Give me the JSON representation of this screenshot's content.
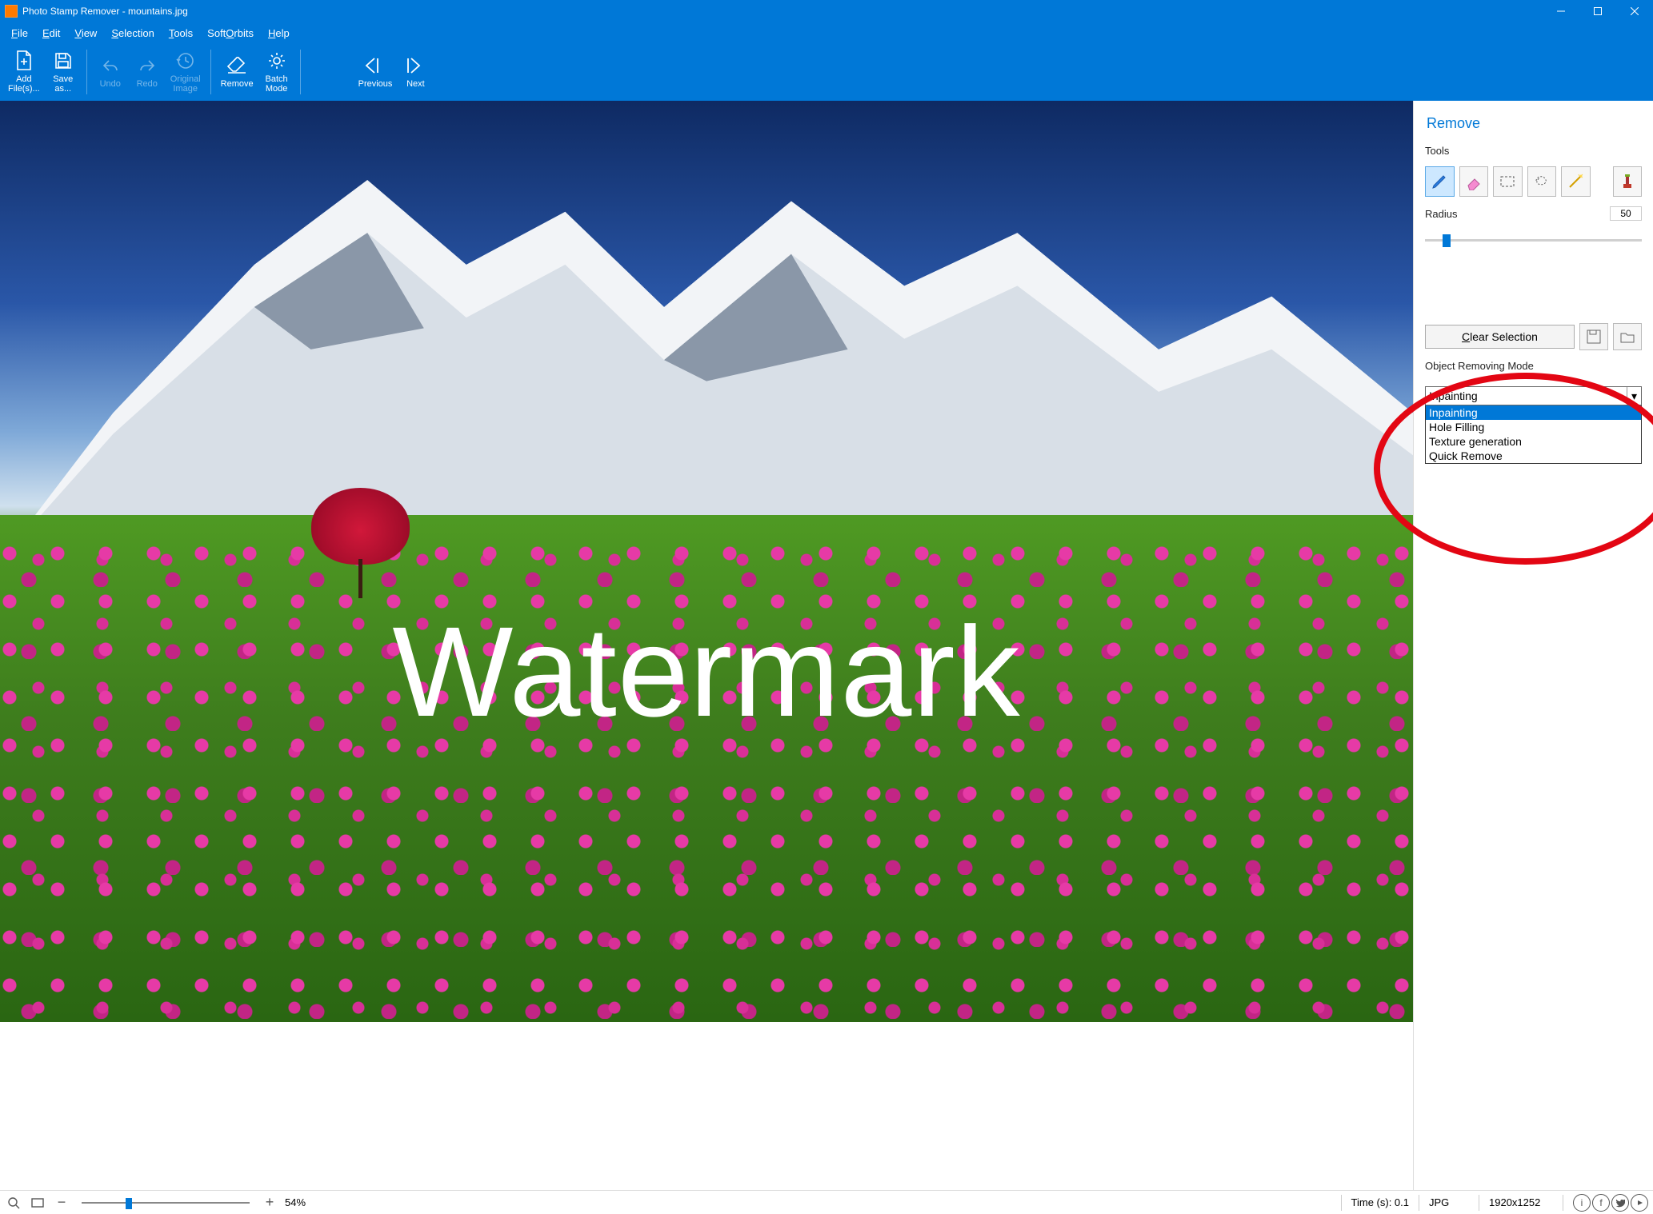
{
  "titlebar": {
    "title": "Photo Stamp Remover - mountains.jpg"
  },
  "menus": [
    "File",
    "Edit",
    "View",
    "Selection",
    "Tools",
    "SoftOrbits",
    "Help"
  ],
  "toolbar": {
    "add": "Add\nFile(s)...",
    "save": "Save\nas...",
    "undo": "Undo",
    "redo": "Redo",
    "original": "Original\nImage",
    "remove": "Remove",
    "batch": "Batch\nMode",
    "previous": "Previous",
    "next": "Next"
  },
  "canvas": {
    "watermark": "Watermark"
  },
  "panel": {
    "title": "Remove",
    "tools_label": "Tools",
    "radius_label": "Radius",
    "radius_value": "50",
    "clear_selection": "Clear Selection",
    "mode_label": "Object Removing Mode",
    "mode_selected": "Inpainting",
    "mode_options": [
      "Inpainting",
      "Hole Filling",
      "Texture generation",
      "Quick Remove"
    ]
  },
  "status": {
    "zoom_pct": "54%",
    "time": "Time (s): 0.1",
    "format": "JPG",
    "dims": "1920x1252"
  }
}
